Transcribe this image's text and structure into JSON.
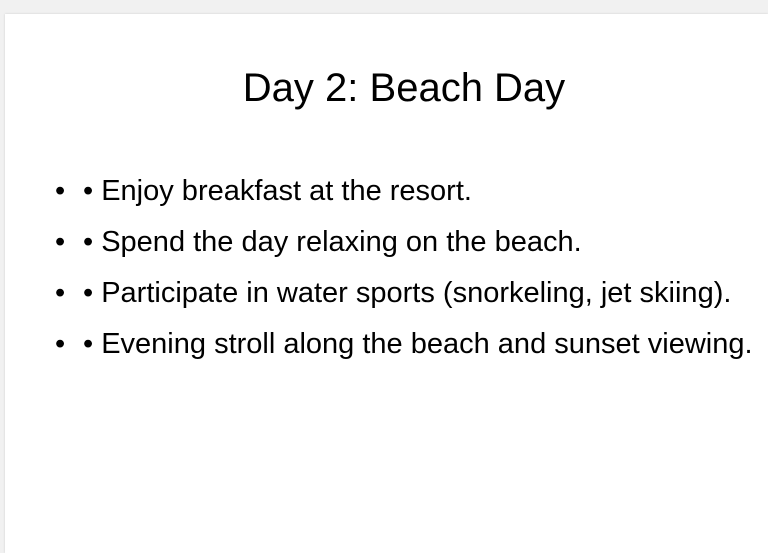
{
  "slide": {
    "title": "Day 2: Beach Day",
    "bullet_marker": "•",
    "bullets": [
      "• Enjoy breakfast at the resort.",
      "• Spend the day relaxing on the beach.",
      "• Participate in water sports (snorkeling, jet skiing).",
      "• Evening stroll along the beach and sunset viewing."
    ]
  }
}
